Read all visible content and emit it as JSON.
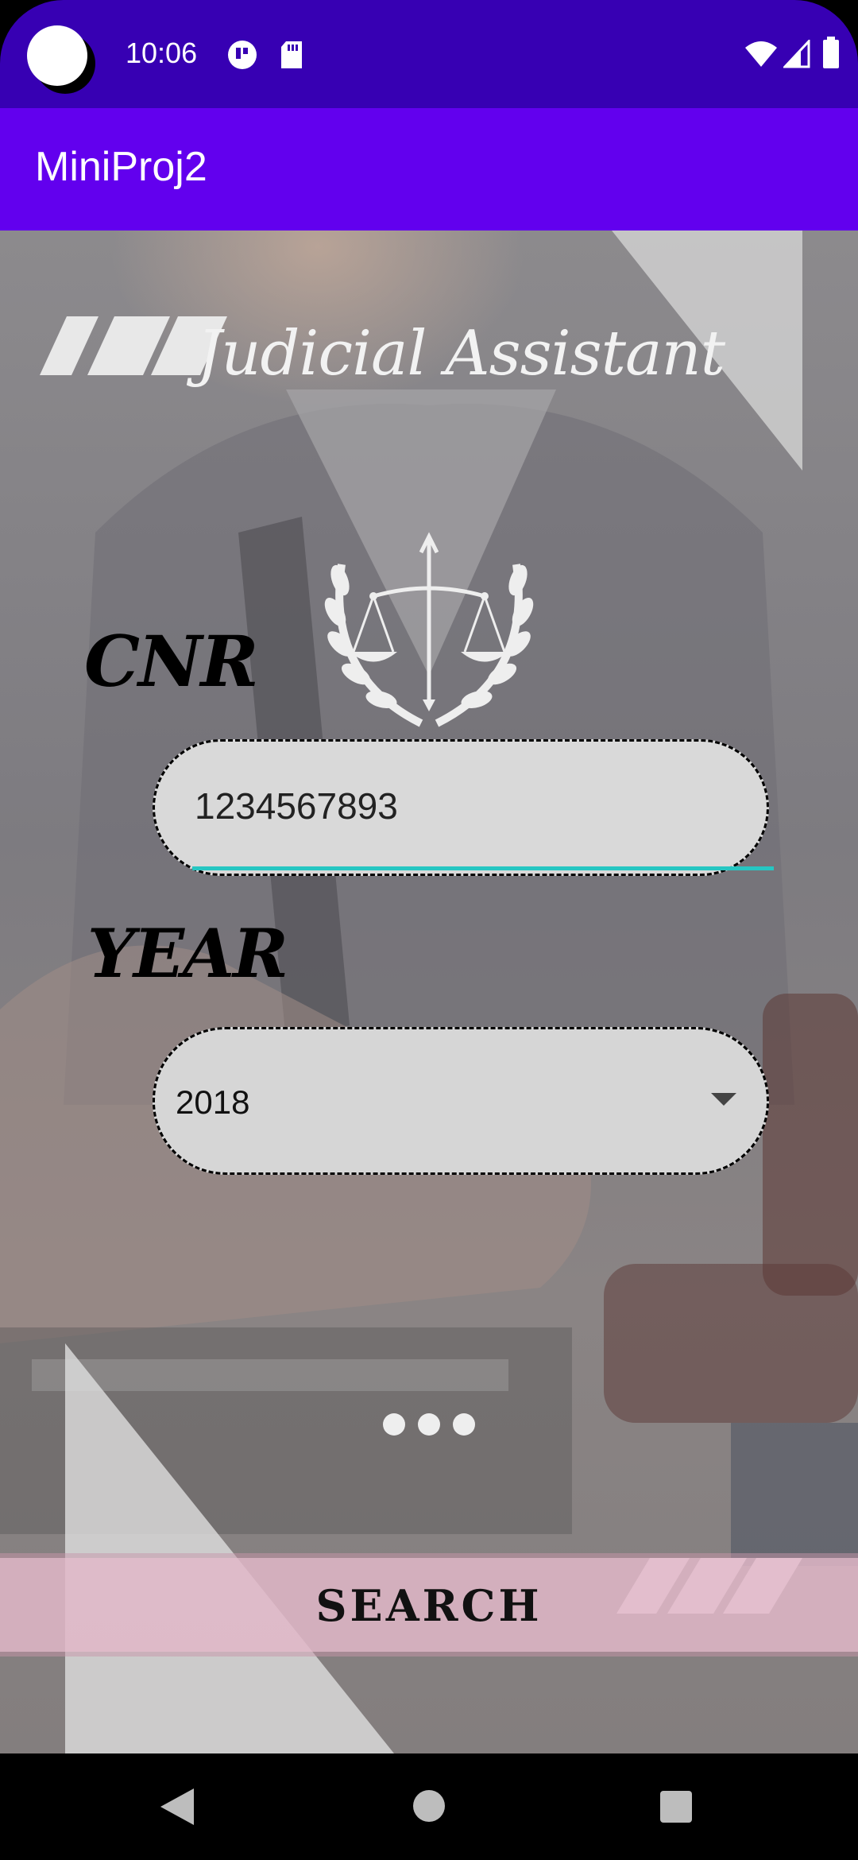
{
  "status_bar": {
    "time": "10:06",
    "icons": [
      "circle-app-icon",
      "sd-card-icon",
      "wifi-icon",
      "signal-icon",
      "battery-icon"
    ]
  },
  "app_bar": {
    "title": "MiniProj2"
  },
  "banner": {
    "logo_text": "Judicial Assistant"
  },
  "form": {
    "cnr_label": "CNR",
    "cnr_value": "1234567893",
    "year_label": "YEAR",
    "year_selected": "2018"
  },
  "search_button": {
    "label": "SEARCH"
  },
  "nav_bar": {
    "buttons": [
      "back",
      "home",
      "recents"
    ]
  },
  "colors": {
    "status_bar": "#3700b3",
    "app_bar": "#6200ee",
    "field_underline": "#26c6c2",
    "search_bar": "#e1b7c8"
  }
}
